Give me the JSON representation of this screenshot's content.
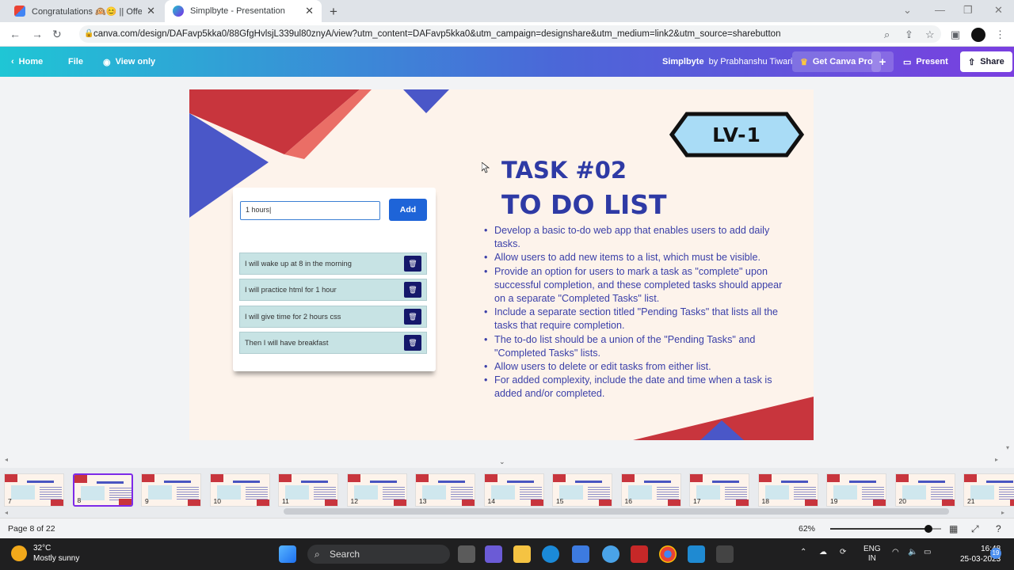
{
  "browser": {
    "tabs": [
      {
        "title": "Congratulations 🙉😊 || Offer le",
        "favicon": "gmail-icon"
      },
      {
        "title": "Simplbyte - Presentation",
        "favicon": "canva-icon"
      }
    ],
    "url": "canva.com/design/DAFavp5kka0/88GfgHvlsjL339ul80znyA/view?utm_content=DAFavp5kka0&utm_campaign=designshare&utm_medium=link2&utm_source=sharebutton"
  },
  "canva_header": {
    "home_label": "Home",
    "file_label": "File",
    "view_only_label": "View only",
    "project_name": "Simplbyte",
    "by_author": "by Prabhanshu Tiwari",
    "get_pro_label": "Get Canva Pro",
    "present_label": "Present",
    "share_label": "Share"
  },
  "slide": {
    "badge": "LV-1",
    "title_line1": "TASK #02",
    "title_line2": "TO DO LIST",
    "bullets": [
      "Develop a basic to-do web app that enables users to add daily tasks.",
      "Allow users to add new items to a list, which must be visible.",
      "Provide an option for users to mark a task as \"complete\" upon successful completion, and these completed tasks should appear on a separate \"Completed Tasks\" list.",
      "Include a separate section titled \"Pending Tasks\" that lists all the tasks that require completion.",
      "The to-do list should be a union of the \"Pending Tasks\" and \"Completed Tasks\" lists.",
      "Allow users to delete or edit tasks from either list.",
      "For added complexity, include the date and time when a task is added and/or completed."
    ],
    "todo_app": {
      "input_value": "1 hours|",
      "add_label": "Add",
      "items": [
        "I will wake up at 8 in the morning",
        "I will practice html for 1 hour",
        "I will give time for 2 hours css",
        "Then I will have breakfast"
      ]
    },
    "colors": {
      "accent_blue": "#2e3aa5",
      "red": "#c8353d",
      "badge_fill": "#a9dcf6"
    }
  },
  "thumbnails": {
    "pages": [
      "7",
      "8",
      "9",
      "10",
      "11",
      "12",
      "13",
      "14",
      "15",
      "16",
      "17",
      "18",
      "19",
      "20",
      "21"
    ],
    "active": "8"
  },
  "footer": {
    "page_indicator": "Page 8 of 22",
    "zoom": "62%",
    "zoom_level": 0.62
  },
  "taskbar": {
    "temperature": "32°C",
    "weather": "Mostly sunny",
    "search_label": "Search",
    "lang_line1": "ENG",
    "lang_line2": "IN",
    "time": "16:48",
    "date": "25-03-2023",
    "notification_count": "19"
  }
}
